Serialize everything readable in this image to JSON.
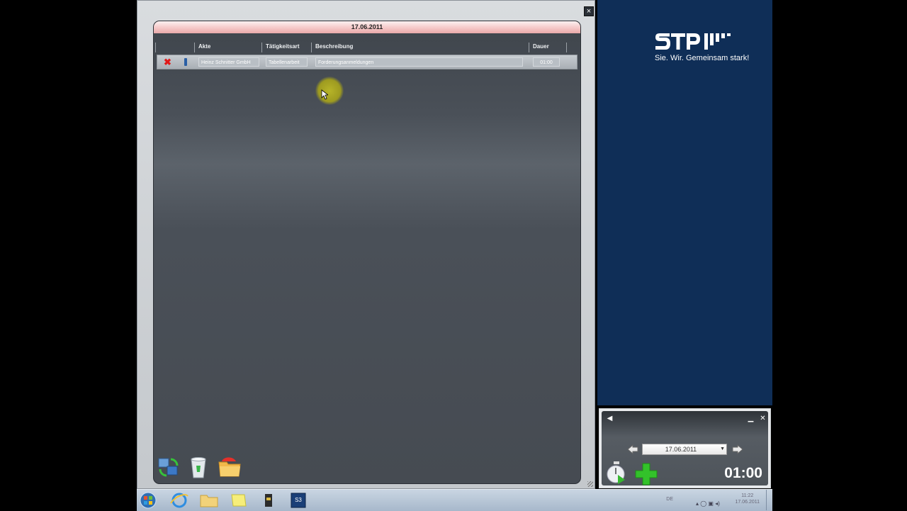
{
  "main_window": {
    "close_icon": "×",
    "header_date": "17.06.2011",
    "columns": {
      "akte": "Akte",
      "taetigkeitsart": "Tätigkeitsart",
      "beschreibung": "Beschreibung",
      "dauer": "Dauer"
    },
    "entry": {
      "akte": "Heinz Schnitter GmbH",
      "taetigkeitsart": "Tabellenarbeit",
      "beschreibung": "Forderungsanmeldungen",
      "dauer": "01:00"
    },
    "delete_icon": "✖"
  },
  "brand": {
    "slogan": "Sie. Wir. Gemeinsam stark!"
  },
  "timer": {
    "date": "17.06.2011",
    "time": "01:00",
    "collapse_icon": "◀",
    "minimize_icon": "▁",
    "close_icon": "✕"
  },
  "taskbar": {
    "tray_language": "DE",
    "clock_time": "11:22",
    "clock_date": "17.06.2011"
  },
  "colors": {
    "brand_blue": "#0f2e57",
    "header_pink": "#f5c8c8",
    "add_green": "#33c22a"
  }
}
